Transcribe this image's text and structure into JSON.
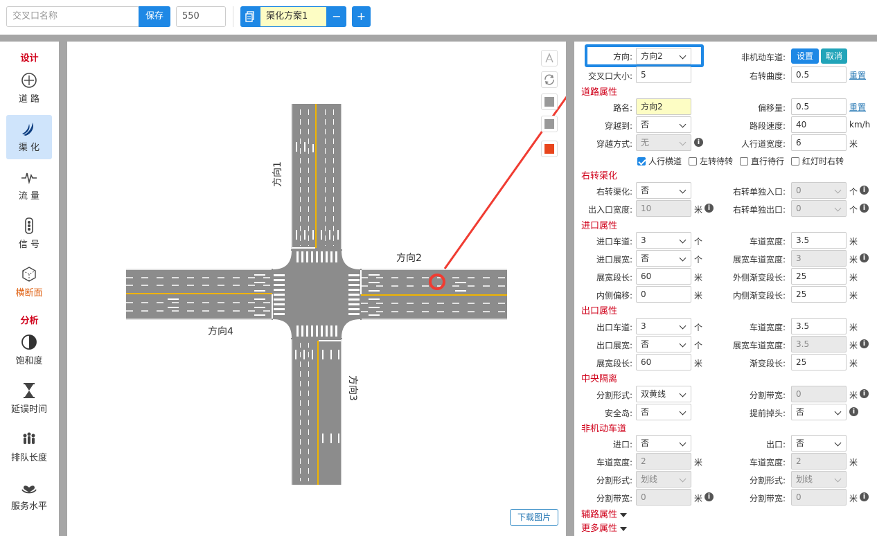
{
  "top": {
    "name_placeholder": "交叉口名称",
    "save_label": "保存",
    "size_value": "550",
    "scheme_name": "渠化方案1",
    "minus_label": "−",
    "plus_label": "+"
  },
  "sidebar": {
    "design_section": "设计",
    "analysis_section": "分析",
    "items": [
      {
        "label": "道 路",
        "icon": "road-icon"
      },
      {
        "label": "渠 化",
        "icon": "channelization-icon"
      },
      {
        "label": "流 量",
        "icon": "flow-icon"
      },
      {
        "label": "信 号",
        "icon": "signal-icon"
      },
      {
        "label": "横断面",
        "icon": "cross-section-icon"
      },
      {
        "label": "饱和度",
        "icon": "saturation-icon"
      },
      {
        "label": "延误时间",
        "icon": "hourglass-icon"
      },
      {
        "label": "排队长度",
        "icon": "queue-icon"
      },
      {
        "label": "服务水平",
        "icon": "service-icon"
      }
    ]
  },
  "canvas": {
    "dir1": "方向1",
    "dir2": "方向2",
    "dir3": "方向3",
    "dir4": "方向4",
    "download_label": "下载图片"
  },
  "panel": {
    "direction_label": "方向:",
    "direction_value": "方向2",
    "nonmotor_label": "非机动车道:",
    "set_label": "设置",
    "cancel_label": "取消",
    "size_label": "交叉口大小:",
    "size_value": "5",
    "right_curve_label": "右转曲度:",
    "right_curve_value": "0.5",
    "reset1": "重置",
    "road_section": "道路属性",
    "road_name_label": "路名:",
    "road_name_value": "方向2",
    "offset_label": "偏移量:",
    "offset_value": "0.5",
    "reset2": "重置",
    "cross_to_label": "穿越到:",
    "cross_to_value": "否",
    "speed_label": "路段速度:",
    "speed_value": "40",
    "speed_unit": "km/h",
    "cross_mode_label": "穿越方式:",
    "cross_mode_value": "无",
    "sidewalk_label": "人行道宽度:",
    "sidewalk_value": "6",
    "unit_m": "米",
    "unit_ge": "个",
    "cb_crosswalk": "人行横道",
    "cb_left_wait": "左转待转",
    "cb_straight_wait": "直行待行",
    "cb_red_right": "红灯时右转",
    "right_section": "右转渠化",
    "right_ch_label": "右转渠化:",
    "right_ch_value": "否",
    "right_in_label": "右转单独入口:",
    "right_in_value": "0",
    "io_width_label": "出入口宽度:",
    "io_width_value": "10",
    "right_out_label": "右转单独出口:",
    "right_out_value": "0",
    "entry_section": "进口属性",
    "entry_lanes_label": "进口车道:",
    "entry_lanes_value": "3",
    "lane_width_label": "车道宽度:",
    "entry_lane_width_value": "3.5",
    "entry_widen_label": "进口展宽:",
    "entry_widen_value": "否",
    "widen_lane_width_label": "展宽车道宽度:",
    "entry_widen_lane_value": "3",
    "widen_len_label": "展宽段长:",
    "entry_widen_len_value": "60",
    "outer_taper_label": "外侧渐变段长:",
    "outer_taper_value": "25",
    "inner_offset_label": "内侧偏移:",
    "inner_offset_value": "0",
    "inner_taper_label": "内侧渐变段长:",
    "inner_taper_value": "25",
    "exit_section": "出口属性",
    "exit_lanes_label": "出口车道:",
    "exit_lanes_value": "3",
    "exit_lane_width_value": "3.5",
    "exit_widen_label": "出口展宽:",
    "exit_widen_value": "否",
    "exit_widen_lane_value": "3.5",
    "exit_widen_len_value": "60",
    "taper_label": "渐变段长:",
    "exit_taper_value": "25",
    "median_section": "中央隔离",
    "divide_form_label": "分割形式:",
    "divide_form_value": "双黄线",
    "divide_width_label": "分割带宽:",
    "divide_width_value": "0",
    "island_label": "安全岛:",
    "island_value": "否",
    "uturn_label": "提前掉头:",
    "uturn_value": "否",
    "nm_section": "非机动车道",
    "nm_in_label": "进口:",
    "nm_in_value": "否",
    "nm_out_label": "出口:",
    "nm_out_value": "否",
    "nm_lw_in_value": "2",
    "nm_lw_out_value": "2",
    "nm_df_in_value": "划线",
    "nm_df_out_value": "划线",
    "nm_dw_in_value": "0",
    "nm_dw_out_value": "0",
    "aux_section": "辅路属性",
    "more_section": "更多属性"
  },
  "colors": {
    "accent": "#1e88e5",
    "section_red": "#d0021b",
    "road": "#8c8c8c",
    "yellow_line": "#f0b400",
    "annotation_red": "#f03c32"
  }
}
